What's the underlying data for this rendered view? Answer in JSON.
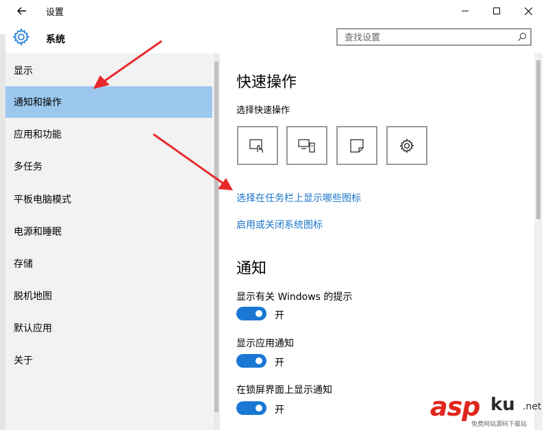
{
  "titlebar": {
    "title": "设置"
  },
  "header": {
    "section_title": "系统",
    "search_placeholder": "查找设置"
  },
  "sidebar": {
    "items": [
      {
        "label": "显示"
      },
      {
        "label": "通知和操作",
        "active": true
      },
      {
        "label": "应用和功能"
      },
      {
        "label": "多任务"
      },
      {
        "label": "平板电脑模式"
      },
      {
        "label": "电源和睡眠"
      },
      {
        "label": "存储"
      },
      {
        "label": "脱机地图"
      },
      {
        "label": "默认应用"
      },
      {
        "label": "关于"
      }
    ]
  },
  "main": {
    "quick_actions_heading": "快速操作",
    "quick_actions_label": "选择快速操作",
    "quick_action_tiles": [
      {
        "icon": "tablet-mode-icon"
      },
      {
        "icon": "connect-icon"
      },
      {
        "icon": "note-icon"
      },
      {
        "icon": "settings-gear-icon"
      }
    ],
    "link_taskbar_icons": "选择在任务栏上显示哪些图标",
    "link_system_icons": "启用或关闭系统图标",
    "notifications_heading": "通知",
    "toggles": [
      {
        "label": "显示有关 Windows 的提示",
        "state": "开"
      },
      {
        "label": "显示应用通知",
        "state": "开"
      },
      {
        "label": "在锁屏界面上显示通知",
        "state": "开"
      }
    ]
  },
  "colors": {
    "accent": "#1a78d4",
    "link": "#1a74c9",
    "selected_nav": "#9cc8ef",
    "annotation_arrow": "#e8282b"
  },
  "watermark": {
    "brand": "asp",
    "brand2": "ku",
    "suffix": ".net",
    "tagline": "免费网站源码下载站"
  }
}
